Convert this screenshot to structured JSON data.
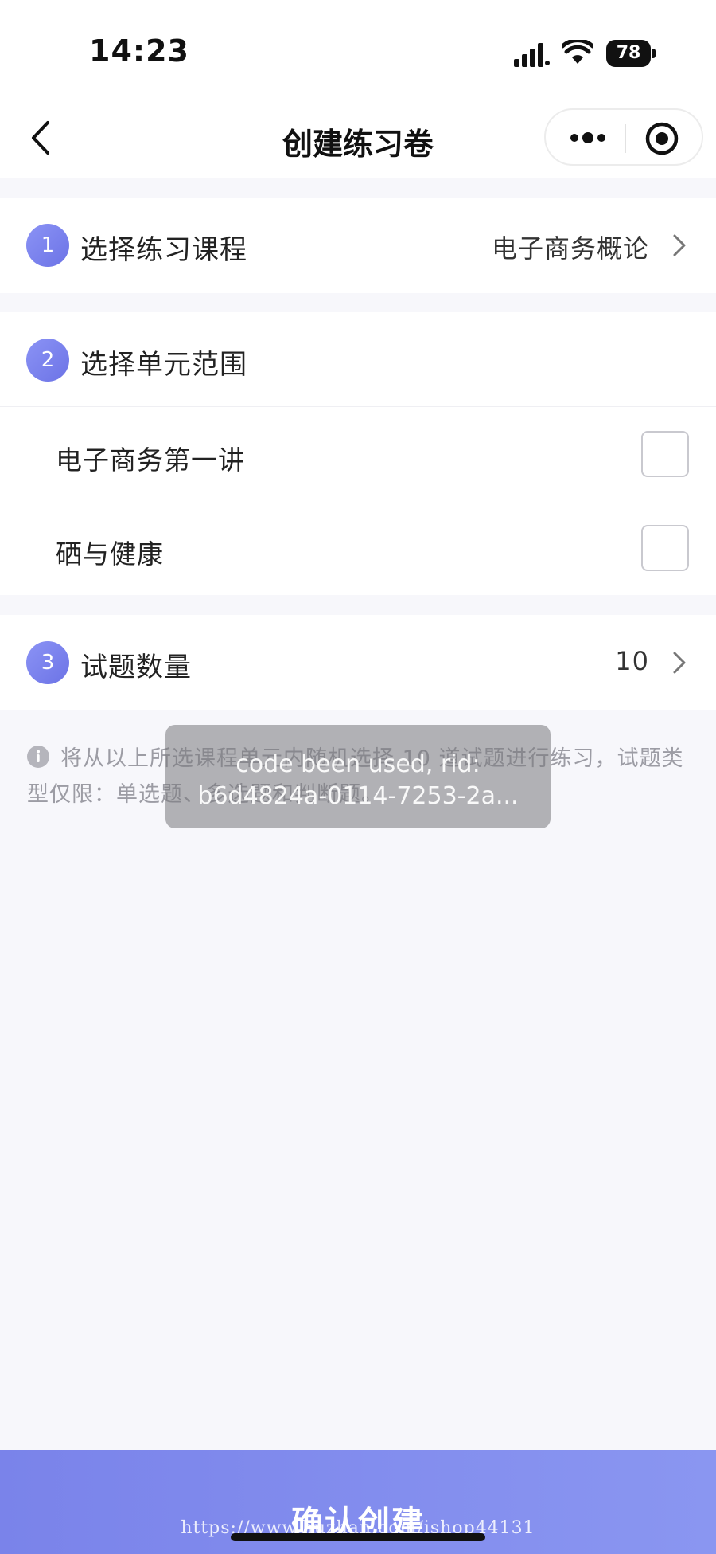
{
  "status_bar": {
    "time": "14:23",
    "battery": "78"
  },
  "nav": {
    "title": "创建练习卷"
  },
  "step1": {
    "number": "1",
    "title": "选择练习课程",
    "value": "电子商务概论"
  },
  "step2": {
    "number": "2",
    "title": "选择单元范围",
    "units": [
      {
        "label": "电子商务第一讲",
        "checked": false
      },
      {
        "label": "硒与健康",
        "checked": false
      }
    ]
  },
  "step3": {
    "number": "3",
    "title": "试题数量",
    "value": "10"
  },
  "note": "将从以上所选课程单元内随机选择 10 道试题进行练习，试题类型仅限：单选题、多选题和判断题。",
  "toast": {
    "line1": "code been used, rid:",
    "line2": "b6d4824a-0114-7253-2a..."
  },
  "confirm_button": "确认创建",
  "watermark": "https://www.huzhan.com/ishop44131",
  "colors": {
    "accent": "#7a83ea",
    "badge": "#6c73e6"
  }
}
